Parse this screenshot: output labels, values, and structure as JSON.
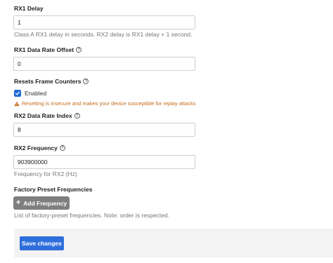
{
  "rx1_delay": {
    "label": "RX1 Delay",
    "value": "1",
    "description": "Class A RX1 delay in seconds. RX2 delay is RX1 delay + 1 second."
  },
  "rx1_dr_offset": {
    "label": "RX1 Data Rate Offset",
    "value": "0"
  },
  "resets_frame_counters": {
    "label": "Resets Frame Counters",
    "checkbox_label": "Enabled",
    "checked": true,
    "warning": "Resetting is insecure and makes your device susceptible for replay attacks"
  },
  "rx2_dr_index": {
    "label": "RX2 Data Rate Index",
    "value": "8"
  },
  "rx2_frequency": {
    "label": "RX2 Frequency",
    "value": "903900000",
    "description": "Frequency for RX2 (Hz)"
  },
  "factory_preset": {
    "label": "Factory Preset Frequencies",
    "add_button": "Add Frequency",
    "description": "List of factory-preset frequencies. Note: order is respected."
  },
  "footer": {
    "save_button": "Save changes"
  },
  "colors": {
    "primary": "#2f6fdc",
    "warning": "#c46a1a",
    "disabled_button": "#7f7f7f"
  }
}
